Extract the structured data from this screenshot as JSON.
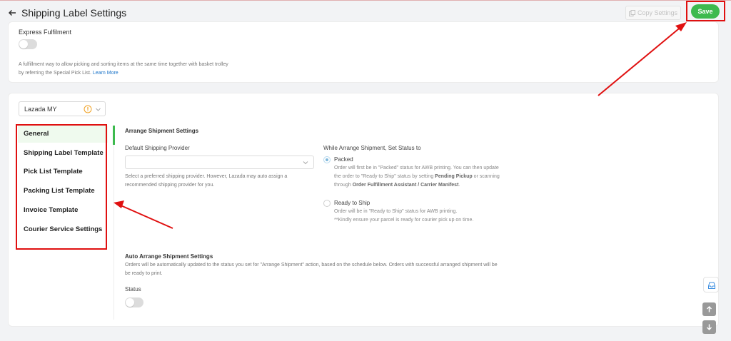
{
  "header": {
    "title": "Shipping Label Settings",
    "copy_label": "Copy Settings",
    "save_label": "Save"
  },
  "express": {
    "label": "Express Fulfilment",
    "desc_line1": "A fulfillment way to allow picking and sorting items at the same time together with basket trolley",
    "desc_line2": "by referring the Special Pick List.",
    "learn_more": "Learn More",
    "toggle_on": false
  },
  "store": {
    "value": "Lazada MY"
  },
  "sidebar": {
    "items": [
      {
        "label": "General"
      },
      {
        "label": "Shipping Label Template"
      },
      {
        "label": "Pick List Template"
      },
      {
        "label": "Packing List Template"
      },
      {
        "label": "Invoice Template"
      },
      {
        "label": "Courier Service Settings"
      }
    ],
    "active": "General"
  },
  "arrange": {
    "title": "Arrange Shipment Settings",
    "provider_label": "Default Shipping Provider",
    "provider_value": "",
    "provider_hint_1": "Select a preferred shipping provider. However, Lazada may auto assign a",
    "provider_hint_2": "recommended shipping provider for you.",
    "status_title": "While Arrange Shipment, Set Status to",
    "options": [
      {
        "label": "Packed",
        "selected": true,
        "desc_1": "Order will first be in \"Packed\" status for AWB printing. You can then update",
        "desc_2a": "the order to \"Ready to Ship\" status by setting ",
        "desc_2b": "Pending Pickup",
        "desc_2c": " or scanning",
        "desc_3a": "through ",
        "desc_3b": "Order Fulfillment Assistant / Carrier Manifest",
        "desc_3c": "."
      },
      {
        "label": "Ready to Ship",
        "selected": false,
        "desc_1": "Order will be in \"Ready to Ship\" status for AWB printing.",
        "desc_2": "**Kindly ensure your parcel is ready for courier pick up on time."
      }
    ]
  },
  "auto": {
    "title": "Auto Arrange Shipment Settings",
    "desc_1": "Orders will be automatically updated to the status you set for \"Arrange Shipment\" action, based on the schedule below. Orders with successful arranged shipment will be",
    "desc_2": "be ready to print.",
    "status_label": "Status",
    "toggle_on": false
  },
  "colors": {
    "accent_green": "#3dba4e",
    "annotation_red": "#e01010",
    "link_blue": "#1a73c8"
  }
}
